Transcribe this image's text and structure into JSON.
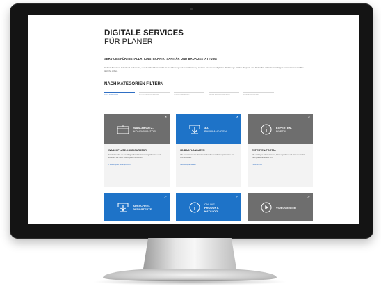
{
  "colors": {
    "accent_blue": "#1e73c8",
    "header_grey": "#6e6e6e",
    "card_bg": "#f3f3f3",
    "link": "#2f6fc4"
  },
  "page": {
    "title": "DIGITALE SERVICES",
    "subtitle": "FÜR PLANER",
    "section_heading": "SERVICES FÜR INSTALLATIONSTECHNIK, SANITÄR UND BADAUSSTATTUNG",
    "intro": "Geberit Services, individuell aufbereitet, von der Produktauswahl bis zur Planung und Ausschreibung. Nutzen Sie unsere digitalen Werkzeuge für Ihre Projekte und finden Sie schnell die richtigen Informationen für Ihre tägliche Arbeit.",
    "filter_heading": "NACH KATEGORIEN FILTERN"
  },
  "tabs": [
    {
      "label": "ALLE SERVICES"
    },
    {
      "label": "PLANUNGSSOFTWARE"
    },
    {
      "label": "AUSSCHREIBUNG"
    },
    {
      "label": "PRODUKTINFORMATION"
    },
    {
      "label": "DOKUMENTATION"
    }
  ],
  "cards": [
    {
      "icon": "sink-icon",
      "header_label": "WASCHPLATZ-",
      "header_label_light": "KONFIGURATOR",
      "title": "WASCHPLATZ-KONFIGURATOR",
      "text": "Entdecken Sie die vielfältigen Kombinations-möglichkeiten und kreieren Sie Ihren Waschplatz individuell.",
      "link": "Waschplatz konfigurieren"
    },
    {
      "icon": "download-icon",
      "header_label": "3D-",
      "header_label_light": "BADPLANDATEN",
      "title": "3D-BADPLANDATEN",
      "text": "Wir unterstützen Ihr Projekt mit detaillierten 3D-Badplandaten für Ihre Software.",
      "link": "3D-Badplandaten"
    },
    {
      "icon": "info-icon",
      "header_label": "EXPERTEN-",
      "header_label_light": "PORTAL",
      "title": "EXPERTEN-PORTAL",
      "text": "Alle wichtigen Informationen, Planungshilfen und Dokumente für Fachplaner an einem Ort.",
      "link": "Zum Portal"
    },
    {
      "icon": "download-icon",
      "header_label": "AUSSCHREI-",
      "header_label_light": "BUNGSTEXTE",
      "title": "",
      "text": "",
      "link": ""
    },
    {
      "icon": "info-icon",
      "header_label": "ONLINE-",
      "header_label_light": "PRODUKT-KATALOG",
      "title": "",
      "text": "",
      "link": ""
    },
    {
      "icon": "play-icon",
      "header_label": "VIDEOCENTER",
      "header_label_light": "",
      "title": "",
      "text": "",
      "link": ""
    }
  ]
}
